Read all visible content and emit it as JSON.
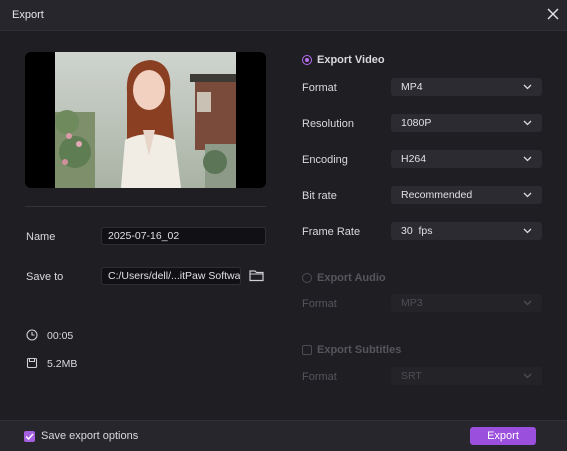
{
  "window": {
    "title": "Export"
  },
  "left": {
    "name_label": "Name",
    "name_value": "2025-07-16_02",
    "save_to_label": "Save to",
    "save_to_value": "C:/Users/dell/...itPaw Software",
    "duration": "00:05",
    "size": "5.2MB"
  },
  "video": {
    "heading": "Export Video",
    "rows": [
      {
        "label": "Format",
        "value": "MP4"
      },
      {
        "label": "Resolution",
        "value": "1080P"
      },
      {
        "label": "Encoding",
        "value": "H264"
      },
      {
        "label": "Bit rate",
        "value": "Recommended"
      },
      {
        "label": "Frame Rate",
        "value": "30  fps"
      }
    ]
  },
  "audio": {
    "heading": "Export Audio",
    "format_label": "Format",
    "format_value": "MP3"
  },
  "subtitles": {
    "heading": "Export Subtitles",
    "format_label": "Format",
    "format_value": "SRT"
  },
  "footer": {
    "save_options_label": "Save export options",
    "export_label": "Export"
  },
  "colors": {
    "accent": "#9b4fdd",
    "background": "#1e1e23"
  },
  "icons": [
    "close-icon",
    "folder-icon",
    "clock-icon",
    "file-size-icon",
    "chevron-down-icon",
    "checkmark-icon"
  ]
}
